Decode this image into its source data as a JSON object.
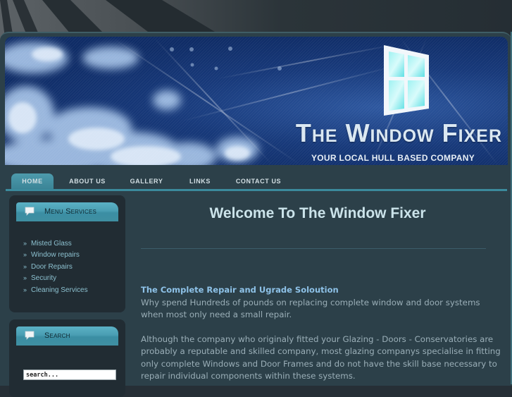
{
  "header": {
    "title": "The Window Fixer",
    "tagline": "YOUR LOCAL HULL BASED COMPANY",
    "logo_icon": "window-icon"
  },
  "nav": {
    "items": [
      {
        "label": "HOME",
        "active": true
      },
      {
        "label": "ABOUT US",
        "active": false
      },
      {
        "label": "GALLERY",
        "active": false
      },
      {
        "label": "LINKS",
        "active": false
      },
      {
        "label": "CONTACT US",
        "active": false
      }
    ]
  },
  "sidebar": {
    "menu_box": {
      "title": "Menu Services",
      "icon": "speech-bubble-icon",
      "items": [
        {
          "label": "Misted Glass",
          "icon": "double-chevron-right-icon"
        },
        {
          "label": "Window repairs",
          "icon": "double-chevron-right-icon"
        },
        {
          "label": "Door Repairs",
          "icon": "double-chevron-right-icon"
        },
        {
          "label": "Security",
          "icon": "double-chevron-right-icon"
        },
        {
          "label": "Cleaning Services",
          "icon": "double-chevron-right-icon"
        }
      ]
    },
    "search_box": {
      "title": "Search",
      "icon": "speech-bubble-icon",
      "placeholder": "search...",
      "value": ""
    }
  },
  "main": {
    "heading": "Welcome To The Window Fixer",
    "subheading": "The Complete Repair and Ugrade Soloution",
    "paragraphs": [
      "Why spend Hundreds of pounds on replacing complete window and door systems when most only need a small repair.",
      "Although the company who originaly fitted your Glazing - Doors - Conservatories are probably a reputable and skilled company, most glazing companys specialise in fitting only complete Windows and Door Frames and do not have the skill base necessary to repair individual components within these systems."
    ]
  },
  "colors": {
    "page_bg": "#2c4049",
    "accent": "#3b8a9c",
    "subheading": "#8ec2e8",
    "body_text": "#9aaeb7",
    "heading_text": "#cbe3ea"
  }
}
